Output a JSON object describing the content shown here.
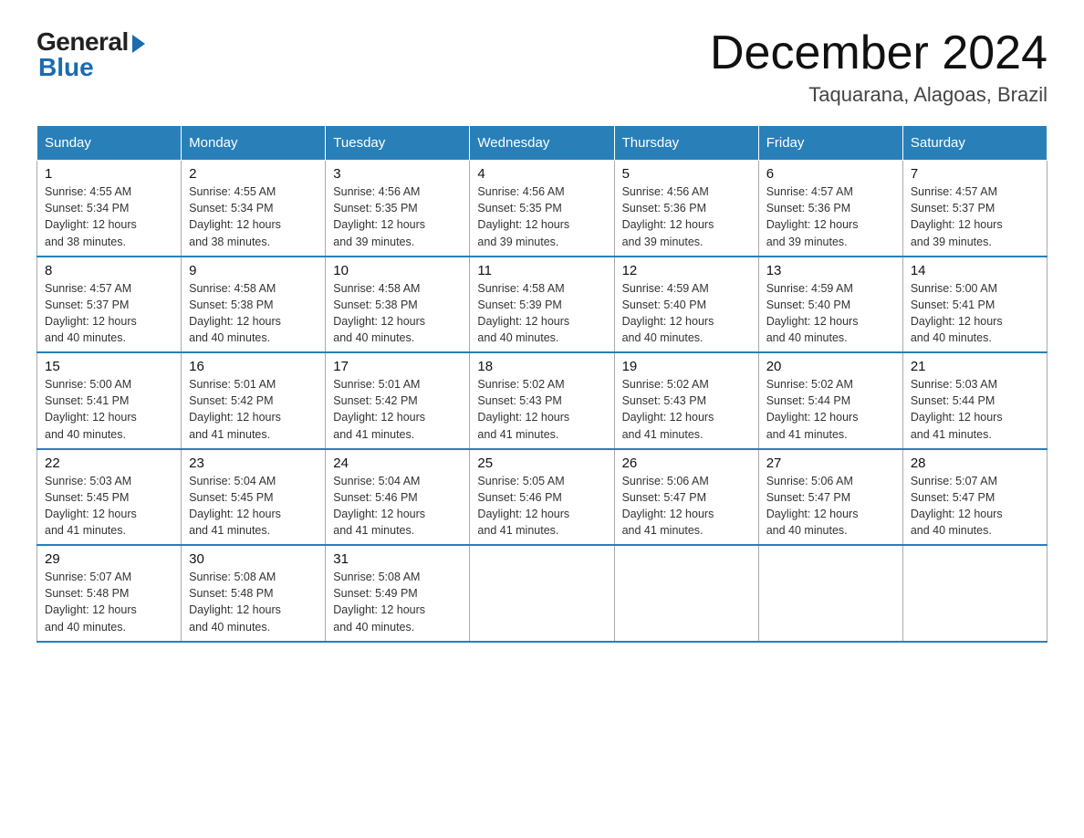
{
  "logo": {
    "general": "General",
    "blue": "Blue"
  },
  "header": {
    "title": "December 2024",
    "subtitle": "Taquarana, Alagoas, Brazil"
  },
  "weekdays": [
    "Sunday",
    "Monday",
    "Tuesday",
    "Wednesday",
    "Thursday",
    "Friday",
    "Saturday"
  ],
  "weeks": [
    [
      {
        "day": "1",
        "sunrise": "4:55 AM",
        "sunset": "5:34 PM",
        "daylight": "12 hours and 38 minutes."
      },
      {
        "day": "2",
        "sunrise": "4:55 AM",
        "sunset": "5:34 PM",
        "daylight": "12 hours and 38 minutes."
      },
      {
        "day": "3",
        "sunrise": "4:56 AM",
        "sunset": "5:35 PM",
        "daylight": "12 hours and 39 minutes."
      },
      {
        "day": "4",
        "sunrise": "4:56 AM",
        "sunset": "5:35 PM",
        "daylight": "12 hours and 39 minutes."
      },
      {
        "day": "5",
        "sunrise": "4:56 AM",
        "sunset": "5:36 PM",
        "daylight": "12 hours and 39 minutes."
      },
      {
        "day": "6",
        "sunrise": "4:57 AM",
        "sunset": "5:36 PM",
        "daylight": "12 hours and 39 minutes."
      },
      {
        "day": "7",
        "sunrise": "4:57 AM",
        "sunset": "5:37 PM",
        "daylight": "12 hours and 39 minutes."
      }
    ],
    [
      {
        "day": "8",
        "sunrise": "4:57 AM",
        "sunset": "5:37 PM",
        "daylight": "12 hours and 40 minutes."
      },
      {
        "day": "9",
        "sunrise": "4:58 AM",
        "sunset": "5:38 PM",
        "daylight": "12 hours and 40 minutes."
      },
      {
        "day": "10",
        "sunrise": "4:58 AM",
        "sunset": "5:38 PM",
        "daylight": "12 hours and 40 minutes."
      },
      {
        "day": "11",
        "sunrise": "4:58 AM",
        "sunset": "5:39 PM",
        "daylight": "12 hours and 40 minutes."
      },
      {
        "day": "12",
        "sunrise": "4:59 AM",
        "sunset": "5:40 PM",
        "daylight": "12 hours and 40 minutes."
      },
      {
        "day": "13",
        "sunrise": "4:59 AM",
        "sunset": "5:40 PM",
        "daylight": "12 hours and 40 minutes."
      },
      {
        "day": "14",
        "sunrise": "5:00 AM",
        "sunset": "5:41 PM",
        "daylight": "12 hours and 40 minutes."
      }
    ],
    [
      {
        "day": "15",
        "sunrise": "5:00 AM",
        "sunset": "5:41 PM",
        "daylight": "12 hours and 40 minutes."
      },
      {
        "day": "16",
        "sunrise": "5:01 AM",
        "sunset": "5:42 PM",
        "daylight": "12 hours and 41 minutes."
      },
      {
        "day": "17",
        "sunrise": "5:01 AM",
        "sunset": "5:42 PM",
        "daylight": "12 hours and 41 minutes."
      },
      {
        "day": "18",
        "sunrise": "5:02 AM",
        "sunset": "5:43 PM",
        "daylight": "12 hours and 41 minutes."
      },
      {
        "day": "19",
        "sunrise": "5:02 AM",
        "sunset": "5:43 PM",
        "daylight": "12 hours and 41 minutes."
      },
      {
        "day": "20",
        "sunrise": "5:02 AM",
        "sunset": "5:44 PM",
        "daylight": "12 hours and 41 minutes."
      },
      {
        "day": "21",
        "sunrise": "5:03 AM",
        "sunset": "5:44 PM",
        "daylight": "12 hours and 41 minutes."
      }
    ],
    [
      {
        "day": "22",
        "sunrise": "5:03 AM",
        "sunset": "5:45 PM",
        "daylight": "12 hours and 41 minutes."
      },
      {
        "day": "23",
        "sunrise": "5:04 AM",
        "sunset": "5:45 PM",
        "daylight": "12 hours and 41 minutes."
      },
      {
        "day": "24",
        "sunrise": "5:04 AM",
        "sunset": "5:46 PM",
        "daylight": "12 hours and 41 minutes."
      },
      {
        "day": "25",
        "sunrise": "5:05 AM",
        "sunset": "5:46 PM",
        "daylight": "12 hours and 41 minutes."
      },
      {
        "day": "26",
        "sunrise": "5:06 AM",
        "sunset": "5:47 PM",
        "daylight": "12 hours and 41 minutes."
      },
      {
        "day": "27",
        "sunrise": "5:06 AM",
        "sunset": "5:47 PM",
        "daylight": "12 hours and 40 minutes."
      },
      {
        "day": "28",
        "sunrise": "5:07 AM",
        "sunset": "5:47 PM",
        "daylight": "12 hours and 40 minutes."
      }
    ],
    [
      {
        "day": "29",
        "sunrise": "5:07 AM",
        "sunset": "5:48 PM",
        "daylight": "12 hours and 40 minutes."
      },
      {
        "day": "30",
        "sunrise": "5:08 AM",
        "sunset": "5:48 PM",
        "daylight": "12 hours and 40 minutes."
      },
      {
        "day": "31",
        "sunrise": "5:08 AM",
        "sunset": "5:49 PM",
        "daylight": "12 hours and 40 minutes."
      },
      null,
      null,
      null,
      null
    ]
  ],
  "labels": {
    "sunrise": "Sunrise:",
    "sunset": "Sunset:",
    "daylight": "Daylight:"
  }
}
